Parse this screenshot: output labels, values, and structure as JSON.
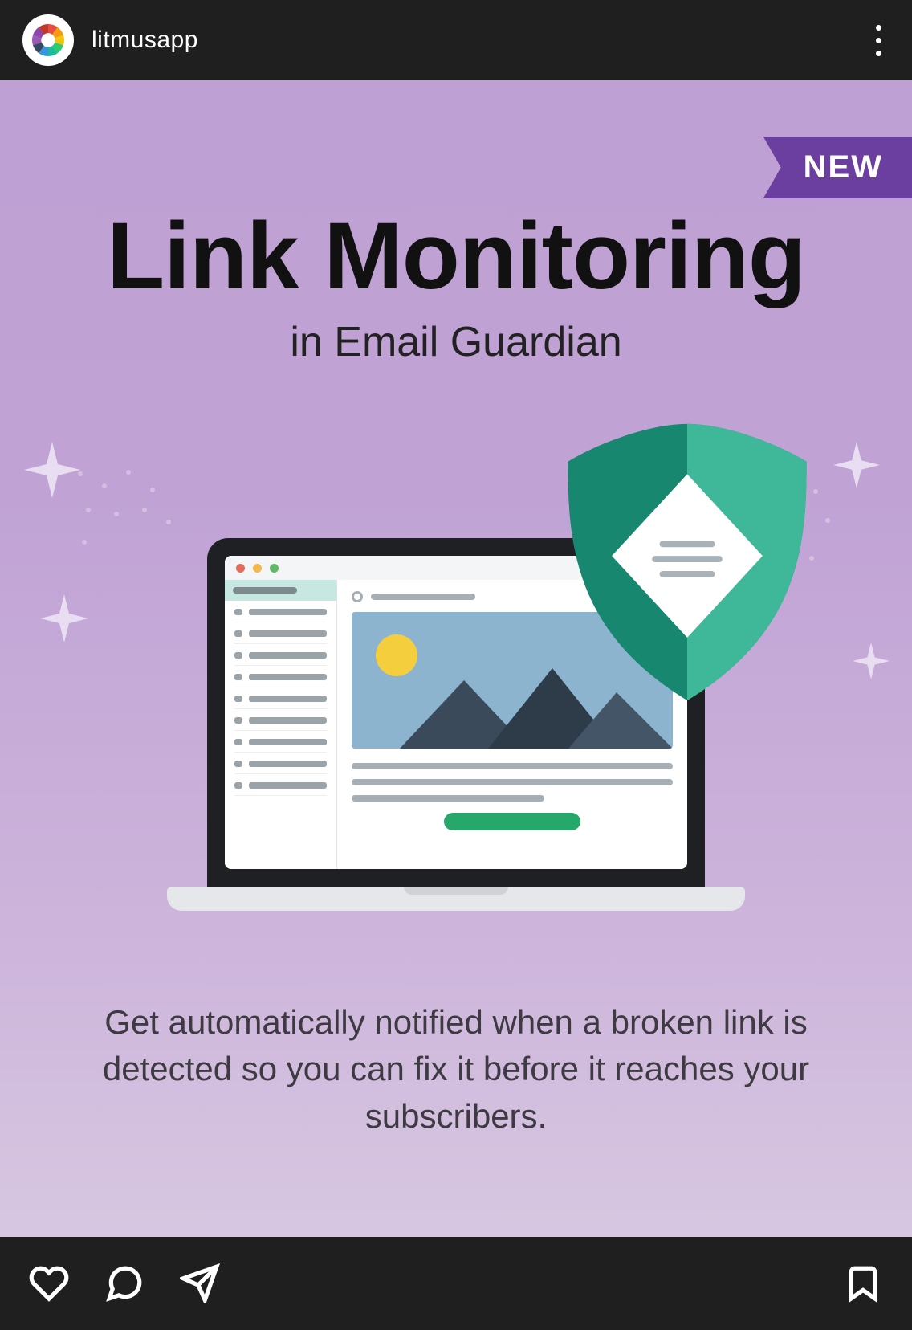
{
  "header": {
    "username": "litmusapp"
  },
  "post": {
    "badge": "NEW",
    "title": "Link Monitoring",
    "subtitle": "in Email Guardian",
    "description": "Get automatically notified when a broken link is detected so you can fix it before it reaches your subscribers."
  },
  "colors": {
    "badge_bg": "#6b3fa0",
    "shield_primary": "#1a9b7f",
    "shield_light": "#4fbfa0",
    "accent_green": "#27a86b"
  }
}
